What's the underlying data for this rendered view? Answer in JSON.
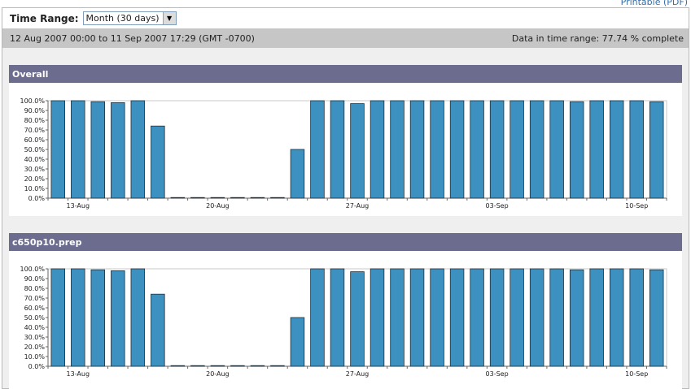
{
  "printable_label": "Printable (PDF)",
  "time_range": {
    "label": "Time Range:",
    "selected": "Month (30 days)"
  },
  "info": {
    "range_text": "12 Aug 2007 00:00 to 11 Sep 2007 17:29 (GMT -0700)",
    "completeness": "Data in time range: 77.74 % complete"
  },
  "sections": [
    {
      "title": "Overall"
    },
    {
      "title": "c650p10.prep"
    }
  ],
  "chart_data": [
    {
      "type": "bar",
      "title": "Overall",
      "ylim": [
        0,
        100
      ],
      "y_ticks": [
        "0.0%",
        "10.0%",
        "20.0%",
        "30.0%",
        "40.0%",
        "50.0%",
        "60.0%",
        "70.0%",
        "80.0%",
        "90.0%",
        "100.0%"
      ],
      "x_tick_labels": [
        "13-Aug",
        "20-Aug",
        "27-Aug",
        "03-Sep",
        "10-Sep"
      ],
      "values": [
        100,
        100,
        99,
        98,
        100,
        74,
        0.5,
        0.5,
        0.5,
        0.5,
        0.5,
        0.5,
        50,
        100,
        100,
        97,
        100,
        100,
        100,
        100,
        100,
        100,
        100,
        100,
        100,
        100,
        99,
        100,
        100,
        100,
        99
      ],
      "bar_color": "#3d91c1",
      "grid": false
    },
    {
      "type": "bar",
      "title": "c650p10.prep",
      "ylim": [
        0,
        100
      ],
      "y_ticks": [
        "0.0%",
        "10.0%",
        "20.0%",
        "30.0%",
        "40.0%",
        "50.0%",
        "60.0%",
        "70.0%",
        "80.0%",
        "90.0%",
        "100.0%"
      ],
      "x_tick_labels": [
        "13-Aug",
        "20-Aug",
        "27-Aug",
        "03-Sep",
        "10-Sep"
      ],
      "values": [
        100,
        100,
        99,
        98,
        100,
        74,
        0.5,
        0.5,
        0.5,
        0.5,
        0.5,
        0.5,
        50,
        100,
        100,
        97,
        100,
        100,
        100,
        100,
        100,
        100,
        100,
        100,
        100,
        100,
        99,
        100,
        100,
        100,
        99
      ],
      "bar_color": "#3d91c1",
      "grid": false
    }
  ]
}
